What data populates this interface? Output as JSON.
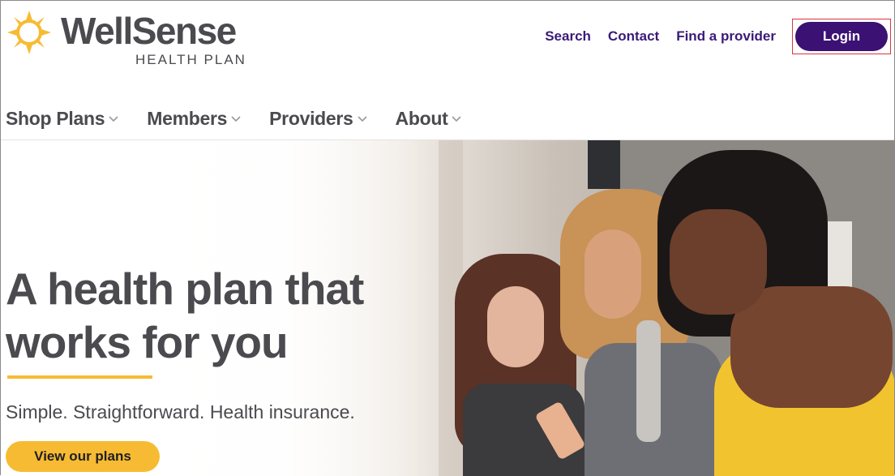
{
  "brand": {
    "name": "WellSense",
    "subtitle": "HEALTH PLAN",
    "sun_color": "#f7bb33"
  },
  "utility_nav": {
    "links": [
      "Search",
      "Contact",
      "Find a provider"
    ],
    "login_label": "Login"
  },
  "main_nav": {
    "items": [
      {
        "label": "Shop Plans",
        "icon": "chevron-down-icon"
      },
      {
        "label": "Members",
        "icon": "chevron-down-icon"
      },
      {
        "label": "Providers",
        "icon": "chevron-down-icon"
      },
      {
        "label": "About",
        "icon": "chevron-down-icon"
      }
    ]
  },
  "hero": {
    "headline": "A health plan that works for you",
    "subheadline": "Simple. Straightforward. Health insurance.",
    "cta_label": "View our plans",
    "image": "three-women-looking-at-phone-photo"
  },
  "colors": {
    "primary_purple": "#3b1173",
    "accent_yellow": "#f7bb33",
    "text_gray": "#4a4a4f"
  }
}
